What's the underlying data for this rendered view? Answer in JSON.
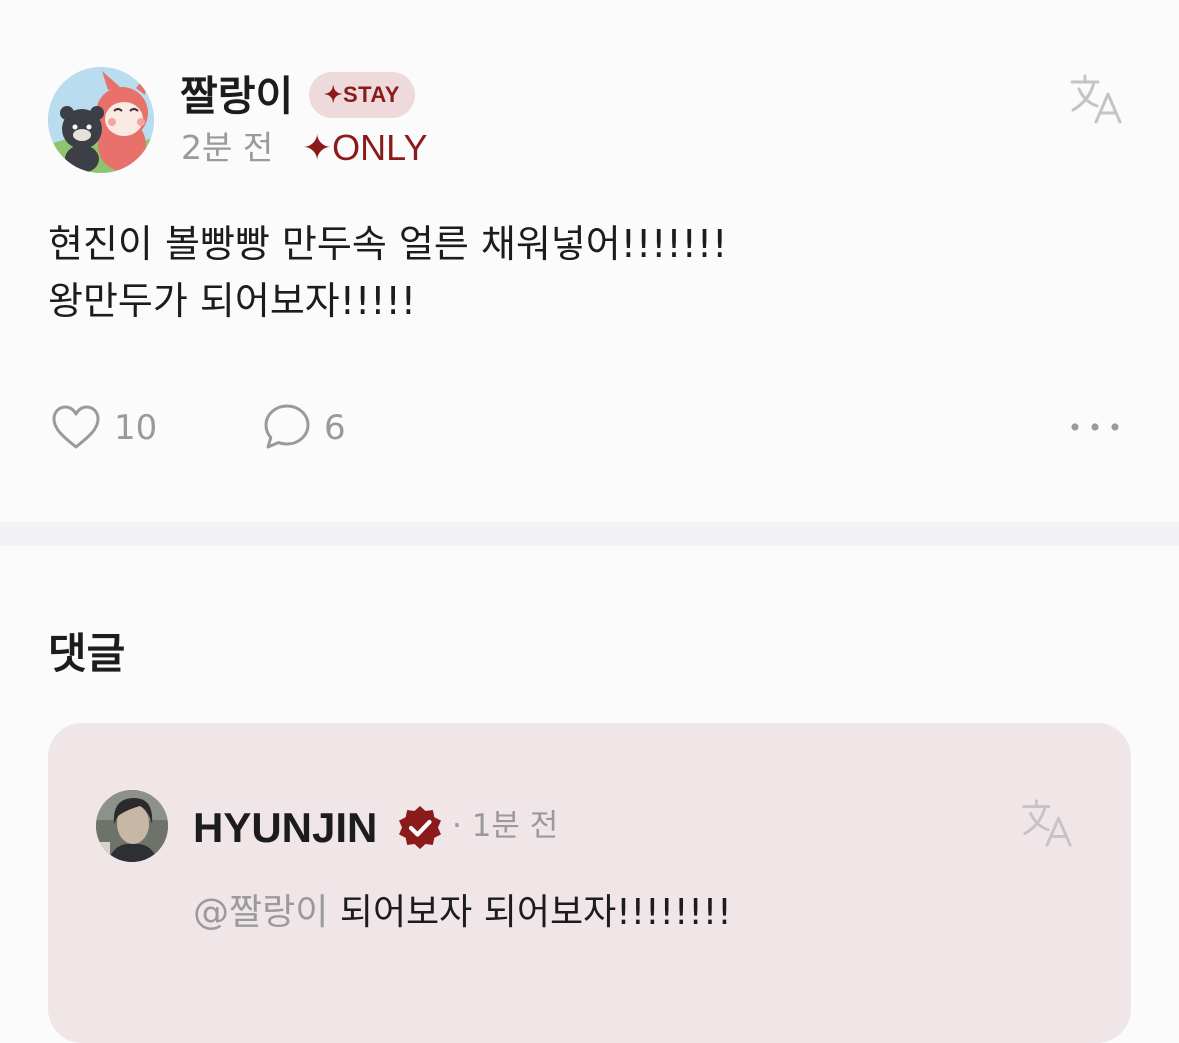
{
  "post": {
    "author_name": "짤랑이",
    "author_badge": "✦STAY",
    "time": "2분 전",
    "only_label": "✦ONLY",
    "body_lines": [
      "현진이 볼빵빵 만두속 얼른 채워넣어!!!!!!!",
      "왕만두가 되어보자!!!!!"
    ],
    "like_count": "10",
    "comment_count": "6"
  },
  "comments_section": {
    "title": "댓글"
  },
  "comment": {
    "author_name": "HYUNJIN",
    "time": "· 1분 전",
    "mention": "@짤랑이",
    "text": " 되어보자 되어보자!!!!!!!!"
  },
  "colors": {
    "accent": "#8b1a1a",
    "badge_bg": "#eed9db",
    "comment_card_bg": "#f1e6e7",
    "muted_text": "#9a9a9e"
  },
  "icons": {
    "translate": "translate-icon",
    "like": "heart-icon",
    "comment": "speech-bubble-icon",
    "more": "more-horizontal-icon",
    "verified": "verified-badge-icon"
  }
}
